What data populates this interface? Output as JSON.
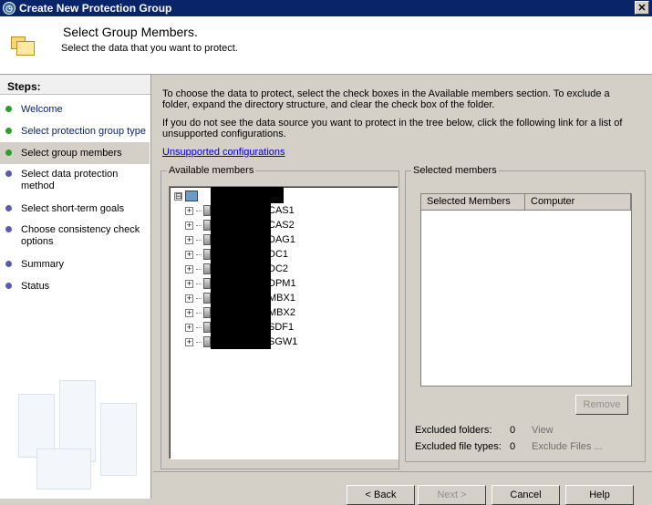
{
  "window": {
    "title": "Create New Protection Group"
  },
  "header": {
    "title": "Select Group Members.",
    "subtitle": "Select the data that you want to protect."
  },
  "steps": {
    "title": "Steps:",
    "items": [
      {
        "label": "Welcome",
        "state": "done"
      },
      {
        "label": "Select protection group type",
        "state": "done"
      },
      {
        "label": "Select group members",
        "state": "current"
      },
      {
        "label": "Select data protection method",
        "state": "pending"
      },
      {
        "label": "Select short-term goals",
        "state": "pending"
      },
      {
        "label": "Choose consistency check options",
        "state": "pending"
      },
      {
        "label": "Summary",
        "state": "pending"
      },
      {
        "label": "Status",
        "state": "pending"
      }
    ]
  },
  "main": {
    "intro": "To choose the data to protect, select the check boxes in the Available members section. To exclude a folder, expand the directory structure, and clear the check box of the folder.",
    "intro2": "If you do not see the data source you want to protect in the tree below, click the following link for a list of unsupported configurations.",
    "link": "Unsupported configurations",
    "available": {
      "legend": "Available members",
      "root_expander": "⊟",
      "servers": [
        {
          "suffix": "CAS1",
          "icon": "server-icon"
        },
        {
          "suffix": "CAS2",
          "icon": "server-icon"
        },
        {
          "suffix": "DAG1",
          "icon": "cluster-icon"
        },
        {
          "suffix": "DC1",
          "icon": "server-icon"
        },
        {
          "suffix": "DC2",
          "icon": "server-icon"
        },
        {
          "suffix": "DPM1",
          "icon": "dpm-icon"
        },
        {
          "suffix": "MBX1",
          "icon": "server-icon"
        },
        {
          "suffix": "MBX2",
          "icon": "server-icon"
        },
        {
          "suffix": "SDF1",
          "icon": "server-icon"
        },
        {
          "suffix": "SGW1",
          "icon": "server-icon"
        }
      ]
    },
    "selected": {
      "legend": "Selected members",
      "columns": [
        "Selected Members",
        "Computer"
      ],
      "remove_label": "Remove",
      "excluded_folders_label": "Excluded folders:",
      "excluded_folders_value": "0",
      "view_label": "View",
      "excluded_types_label": "Excluded file types:",
      "excluded_types_value": "0",
      "exclude_files_label": "Exclude Files ..."
    },
    "buttons": {
      "back": "< Back",
      "next": "Next >",
      "cancel": "Cancel",
      "help": "Help"
    }
  },
  "colors": {
    "titlebar": "#0a246a",
    "link": "#0000cc",
    "step_done": "#2e9c2e",
    "step_pending": "#5a5ab0"
  }
}
